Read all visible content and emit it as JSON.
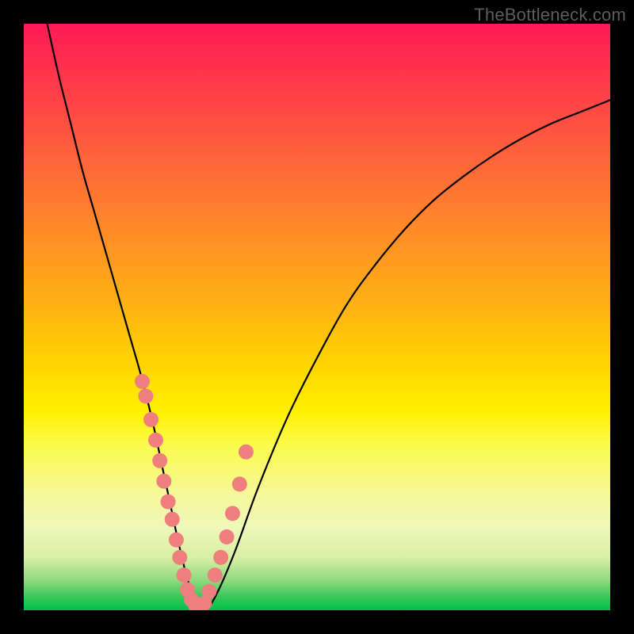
{
  "watermark": "TheBottleneck.com",
  "chart_data": {
    "type": "line",
    "title": "",
    "xlabel": "",
    "ylabel": "",
    "xlim": [
      0,
      100
    ],
    "ylim": [
      0,
      100
    ],
    "grid": false,
    "series": [
      {
        "name": "main-curve",
        "color": "#000000",
        "x": [
          4,
          6,
          8,
          10,
          12,
          14,
          16,
          18,
          20,
          22,
          23.5,
          25,
          26.5,
          28,
          29.5,
          31,
          33,
          36,
          40,
          45,
          50,
          55,
          60,
          65,
          70,
          75,
          80,
          85,
          90,
          95,
          100
        ],
        "y": [
          100,
          91,
          83,
          75,
          68,
          61,
          54,
          47,
          40,
          32,
          25,
          18,
          11,
          5,
          1,
          0,
          3,
          10,
          21,
          33,
          43,
          52,
          59,
          65,
          70,
          74,
          77.5,
          80.5,
          83,
          85,
          87
        ]
      },
      {
        "name": "scatter-dots",
        "type": "scatter",
        "color": "#ef7f7f",
        "x": [
          20.2,
          20.8,
          21.7,
          22.5,
          23.2,
          23.9,
          24.6,
          25.3,
          26.0,
          26.6,
          27.3,
          27.9,
          28.6,
          29.3,
          30.0,
          30.8,
          31.6,
          32.6,
          33.6,
          34.6,
          35.6,
          36.8,
          37.9
        ],
        "y": [
          39.0,
          36.5,
          32.5,
          29.0,
          25.5,
          22.0,
          18.5,
          15.5,
          12.0,
          9.0,
          6.0,
          3.5,
          1.8,
          0.8,
          0.5,
          1.2,
          3.2,
          6.0,
          9.0,
          12.5,
          16.5,
          21.5,
          27.0
        ]
      }
    ],
    "gradient_stops": [
      {
        "pos": 0.0,
        "color": "#ff1a55"
      },
      {
        "pos": 0.5,
        "color": "#ffb810"
      },
      {
        "pos": 0.72,
        "color": "#fbfb4d"
      },
      {
        "pos": 1.0,
        "color": "#00c04b"
      }
    ]
  }
}
